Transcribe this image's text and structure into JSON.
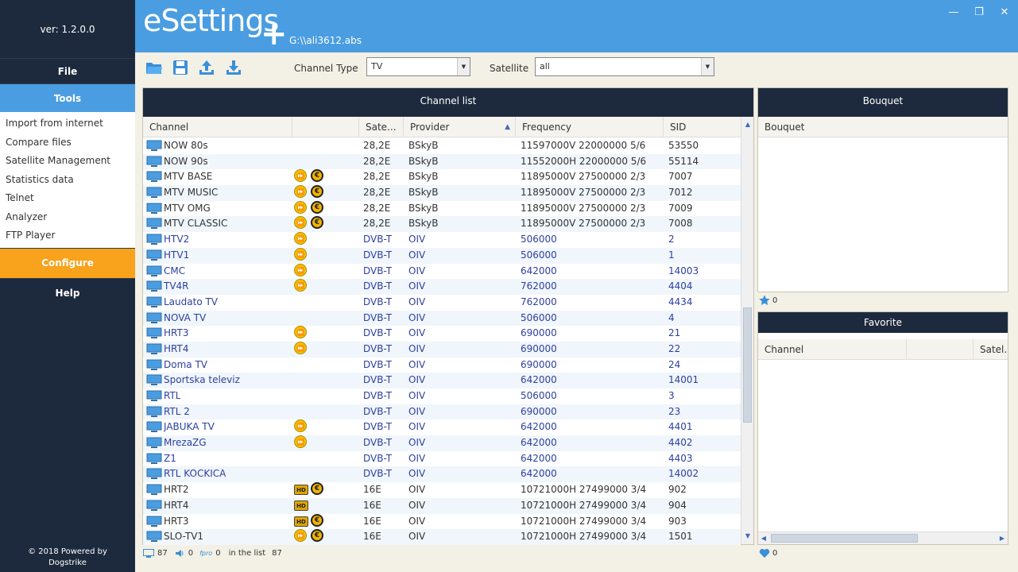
{
  "sidebar": {
    "version": "ver: 1.2.0.0",
    "file": "File",
    "tools": "Tools",
    "tool_items": [
      "Import from internet",
      "Compare files",
      "Satellite Management",
      "Statistics data",
      "Telnet",
      "Analyzer",
      "FTP Player"
    ],
    "configure": "Configure",
    "help": "Help",
    "powered_line1": "© 2018 Powered by",
    "powered_line2": "Dogstrike"
  },
  "header": {
    "logo": "eSettings",
    "logo_plus": "+",
    "file_path": "G:\\\\ali3612.abs"
  },
  "toolbar": {
    "channel_type_label": "Channel Type",
    "channel_type_value": "TV",
    "satellite_label": "Satellite",
    "satellite_value": "all"
  },
  "channel_list": {
    "title": "Channel list",
    "columns": [
      "Channel",
      "",
      "Sate...",
      "Provider",
      "Frequency",
      "SID"
    ],
    "rows": [
      {
        "name": "NOW 80s",
        "icons": [],
        "sat": "28,2E",
        "provider": "BSkyB",
        "freq": "11597000V 22000000 5/6",
        "sid": "53550",
        "style": "dark"
      },
      {
        "name": "NOW 90s",
        "icons": [],
        "sat": "28,2E",
        "provider": "BSkyB",
        "freq": "11552000H 22000000 5/6",
        "sid": "55114",
        "style": "dark"
      },
      {
        "name": "MTV BASE",
        "icons": [
          "ff",
          "euro"
        ],
        "sat": "28,2E",
        "provider": "BSkyB",
        "freq": "11895000V 27500000 2/3",
        "sid": "7007",
        "style": "dark"
      },
      {
        "name": "MTV MUSIC",
        "icons": [
          "ff",
          "euro"
        ],
        "sat": "28,2E",
        "provider": "BSkyB",
        "freq": "11895000V 27500000 2/3",
        "sid": "7012",
        "style": "dark"
      },
      {
        "name": "MTV OMG",
        "icons": [
          "ff",
          "euro"
        ],
        "sat": "28,2E",
        "provider": "BSkyB",
        "freq": "11895000V 27500000 2/3",
        "sid": "7009",
        "style": "dark"
      },
      {
        "name": "MTV CLASSIC",
        "icons": [
          "ff",
          "euro"
        ],
        "sat": "28,2E",
        "provider": "BSkyB",
        "freq": "11895000V 27500000 2/3",
        "sid": "7008",
        "style": "dark"
      },
      {
        "name": "HTV2",
        "icons": [
          "ff"
        ],
        "sat": "DVB-T",
        "provider": "OIV",
        "freq": "506000",
        "sid": "2",
        "style": "blue"
      },
      {
        "name": "HTV1",
        "icons": [
          "ff"
        ],
        "sat": "DVB-T",
        "provider": "OIV",
        "freq": "506000",
        "sid": "1",
        "style": "blue"
      },
      {
        "name": "CMC",
        "icons": [
          "ff"
        ],
        "sat": "DVB-T",
        "provider": "OIV",
        "freq": "642000",
        "sid": "14003",
        "style": "blue"
      },
      {
        "name": "TV4R",
        "icons": [
          "ff"
        ],
        "sat": "DVB-T",
        "provider": "OIV",
        "freq": "762000",
        "sid": "4404",
        "style": "blue"
      },
      {
        "name": "Laudato TV",
        "icons": [],
        "sat": "DVB-T",
        "provider": "OIV",
        "freq": "762000",
        "sid": "4434",
        "style": "blue"
      },
      {
        "name": "NOVA TV",
        "icons": [],
        "sat": "DVB-T",
        "provider": "OIV",
        "freq": "506000",
        "sid": "4",
        "style": "blue"
      },
      {
        "name": "HRT3",
        "icons": [
          "ff"
        ],
        "sat": "DVB-T",
        "provider": "OIV",
        "freq": "690000",
        "sid": "21",
        "style": "blue"
      },
      {
        "name": "HRT4",
        "icons": [
          "ff"
        ],
        "sat": "DVB-T",
        "provider": "OIV",
        "freq": "690000",
        "sid": "22",
        "style": "blue"
      },
      {
        "name": "Doma TV",
        "icons": [],
        "sat": "DVB-T",
        "provider": "OIV",
        "freq": "690000",
        "sid": "24",
        "style": "blue"
      },
      {
        "name": "Sportska televiz",
        "icons": [],
        "sat": "DVB-T",
        "provider": "OIV",
        "freq": "642000",
        "sid": "14001",
        "style": "blue"
      },
      {
        "name": "RTL",
        "icons": [],
        "sat": "DVB-T",
        "provider": "OIV",
        "freq": "506000",
        "sid": "3",
        "style": "blue"
      },
      {
        "name": "RTL 2",
        "icons": [],
        "sat": "DVB-T",
        "provider": "OIV",
        "freq": "690000",
        "sid": "23",
        "style": "blue"
      },
      {
        "name": "JABUKA TV",
        "icons": [
          "ff"
        ],
        "sat": "DVB-T",
        "provider": "OIV",
        "freq": "642000",
        "sid": "4401",
        "style": "blue"
      },
      {
        "name": "MrezaZG",
        "icons": [
          "ff"
        ],
        "sat": "DVB-T",
        "provider": "OIV",
        "freq": "642000",
        "sid": "4402",
        "style": "blue"
      },
      {
        "name": "Z1",
        "icons": [],
        "sat": "DVB-T",
        "provider": "OIV",
        "freq": "642000",
        "sid": "4403",
        "style": "blue"
      },
      {
        "name": "RTL KOCKICA",
        "icons": [],
        "sat": "DVB-T",
        "provider": "OIV",
        "freq": "642000",
        "sid": "14002",
        "style": "blue"
      },
      {
        "name": " HRT2",
        "icons": [
          "hd",
          "euro"
        ],
        "sat": "16E",
        "provider": "OIV",
        "freq": "10721000H 27499000 3/4",
        "sid": "902",
        "style": "dark"
      },
      {
        "name": " HRT4",
        "icons": [
          "hd"
        ],
        "sat": "16E",
        "provider": "OIV",
        "freq": "10721000H 27499000 3/4",
        "sid": "904",
        "style": "dark"
      },
      {
        "name": " HRT3",
        "icons": [
          "hd",
          "euro"
        ],
        "sat": "16E",
        "provider": "OIV",
        "freq": "10721000H 27499000 3/4",
        "sid": "903",
        "style": "dark"
      },
      {
        "name": "SLO-TV1",
        "icons": [
          "ff",
          "euro"
        ],
        "sat": "16E",
        "provider": "OIV",
        "freq": "10721000H 27499000 3/4",
        "sid": "1501",
        "style": "dark"
      }
    ]
  },
  "status": {
    "tv_count": "87",
    "radio_count": "0",
    "other_count": "0",
    "in_list_label": "in the list",
    "in_list_count": "87"
  },
  "bouquet": {
    "title": "Bouquet",
    "column": "Bouquet",
    "count": "0"
  },
  "favorite": {
    "title": "Favorite",
    "columns": [
      "Channel",
      "",
      "Satel."
    ],
    "count": "0"
  },
  "colors": {
    "sidebar": "#1d2a3e",
    "accent_blue": "#4a9de0",
    "accent_orange": "#f9a21b"
  }
}
